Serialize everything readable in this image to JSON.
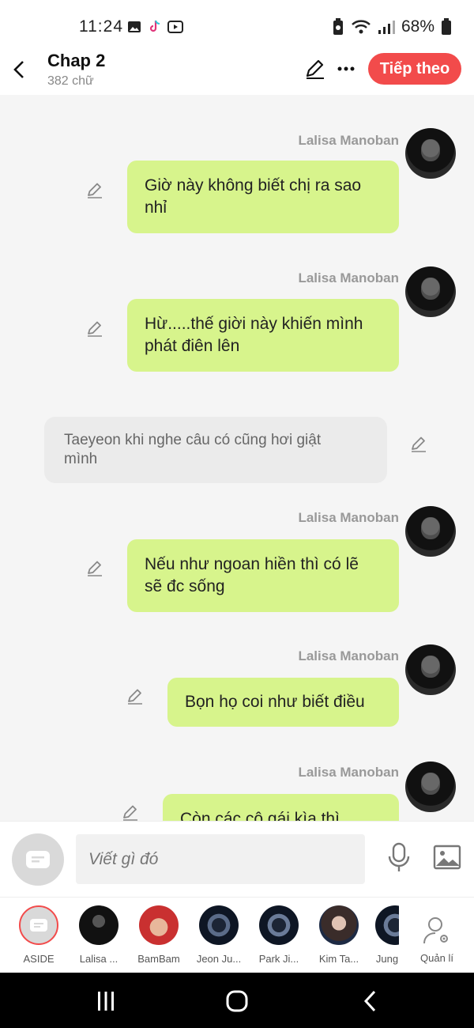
{
  "status_bar": {
    "time": "11:24",
    "battery": "68%",
    "left_icons": [
      "gallery-icon",
      "tiktok-icon",
      "youtube-icon"
    ],
    "right_icons": [
      "battery-saver-icon",
      "wifi-icon",
      "signal-icon",
      "battery-icon"
    ]
  },
  "header": {
    "title": "Chap 2",
    "subtitle": "382 chữ",
    "next_label": "Tiếp theo",
    "accent_color": "#f24b4b"
  },
  "messages": [
    {
      "type": "chat",
      "sender": "Lalisa Manoban",
      "lines": [
        "Giờ này không biết chị ra sao",
        "nhỉ"
      ]
    },
    {
      "type": "chat",
      "sender": "Lalisa Manoban",
      "lines": [
        "Hừ.....thế giời này khiến mình",
        "phát điên lên"
      ]
    },
    {
      "type": "narration",
      "lines": [
        "Taeyeon khi nghe câu có cũng hơi giật",
        "mình"
      ]
    },
    {
      "type": "chat",
      "sender": "Lalisa Manoban",
      "lines": [
        "Nếu như ngoan hiền thì có lẽ",
        "sẽ đc sống"
      ]
    },
    {
      "type": "chat",
      "sender": "Lalisa Manoban",
      "lines": [
        "Bọn họ coi như biết điều"
      ]
    },
    {
      "type": "chat",
      "sender": "Lalisa Manoban",
      "lines": [
        "Còn các cô gái kìa thì"
      ]
    }
  ],
  "composer": {
    "placeholder": "Viết gì đó",
    "bubble_color": "#d7f48c"
  },
  "characters": [
    {
      "label": "ASIDE"
    },
    {
      "label": "Lalisa ..."
    },
    {
      "label": "BamBam"
    },
    {
      "label": "Jeon Ju..."
    },
    {
      "label": "Park Ji..."
    },
    {
      "label": "Kim Ta..."
    },
    {
      "label": "Jung"
    }
  ],
  "manage_label": "Quản lí"
}
